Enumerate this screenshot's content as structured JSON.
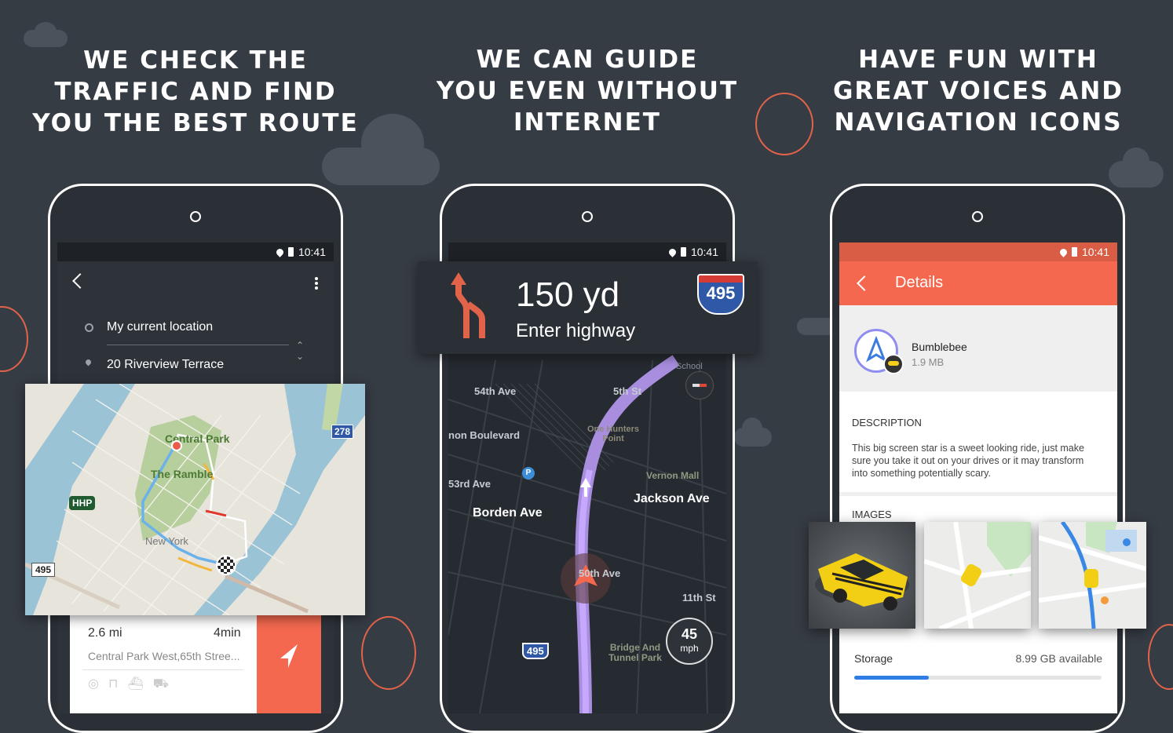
{
  "panels": [
    {
      "headline": [
        "WE CHECK THE",
        "TRAFFIC AND FIND",
        "YOU THE BEST ROUTE"
      ]
    },
    {
      "headline": [
        "WE CAN GUIDE",
        "YOU EVEN WITHOUT",
        "INTERNET"
      ]
    },
    {
      "headline": [
        "HAVE FUN WITH",
        "GREAT VOICES AND",
        "NAVIGATION ICONS"
      ]
    }
  ],
  "status_time": "10:41",
  "route_screen": {
    "from": "My current location",
    "to": "20 Riverview Terrace",
    "map_labels": {
      "park": "Central Park",
      "ramble": "The Ramble",
      "neighborhood": "New York",
      "hhp": "HHP",
      "shield_278": "278",
      "shield_495": "495"
    },
    "distance": "2.6 mi",
    "duration": "4min",
    "destination": "Central Park West,65th Stree..."
  },
  "nav_screen": {
    "distance": "150 yd",
    "instruction": "Enter highway",
    "shield": "495",
    "streets": [
      "54th Ave",
      "5th St",
      "School",
      "non Boulevard",
      "One Hunters Point",
      "53rd Ave",
      "Vernon Mall",
      "Jackson Ave",
      "Borden Ave",
      "50th Ave",
      "11th St",
      "Bridge And Tunnel Park"
    ],
    "bottom_shield": "495",
    "speed": "45",
    "speed_unit": "mph"
  },
  "details_screen": {
    "title": "Details",
    "item_name": "Bumblebee",
    "item_size": "1.9 MB",
    "description_heading": "DESCRIPTION",
    "description": "This big screen star is a sweet looking ride, just make sure you take it out on your drives or it may transform into something potentially scary.",
    "images_heading": "IMAGES",
    "storage_label": "Storage",
    "storage_value": "8.99 GB available",
    "storage_used_fraction": 0.3,
    "accent_color": "#f3684f"
  }
}
